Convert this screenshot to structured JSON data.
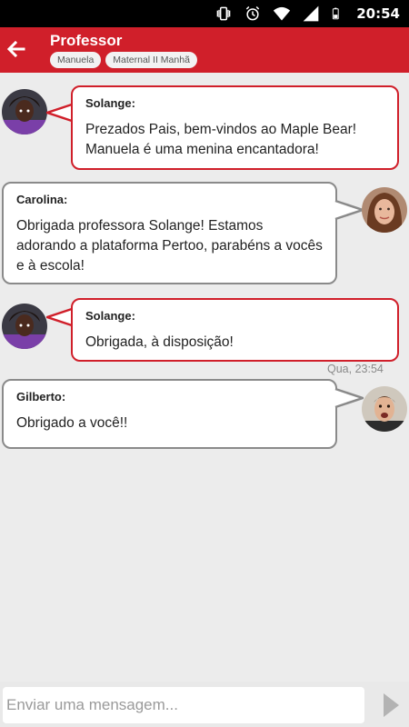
{
  "status_bar": {
    "time": "20:54",
    "icons": [
      "vibrate-icon",
      "alarm-icon",
      "wifi-icon",
      "signal-icon",
      "battery-icon"
    ]
  },
  "header": {
    "title": "Professor",
    "chips": [
      "Manuela",
      "Maternal II Manhã"
    ]
  },
  "messages": [
    {
      "sender": "Solange:",
      "text": "Prezados Pais, bem-vindos ao Maple Bear! Manuela é uma menina encantadora!",
      "side": "left"
    },
    {
      "sender": "Carolina:",
      "text": "Obrigada professora Solange! Estamos adorando a plataforma Pertoo, parabéns a vocês e à escola!",
      "side": "right"
    },
    {
      "sender": "Solange:",
      "text": "Obrigada, à disposição!",
      "side": "left",
      "timestamp": "Qua, 23:54"
    },
    {
      "sender": "Gilberto:",
      "text": "Obrigado a você!!",
      "side": "right"
    }
  ],
  "composer": {
    "placeholder": "Enviar uma mensagem..."
  },
  "colors": {
    "accent": "#d01f2a",
    "background": "#ececec",
    "outgoing_border": "#8a8a8a"
  }
}
